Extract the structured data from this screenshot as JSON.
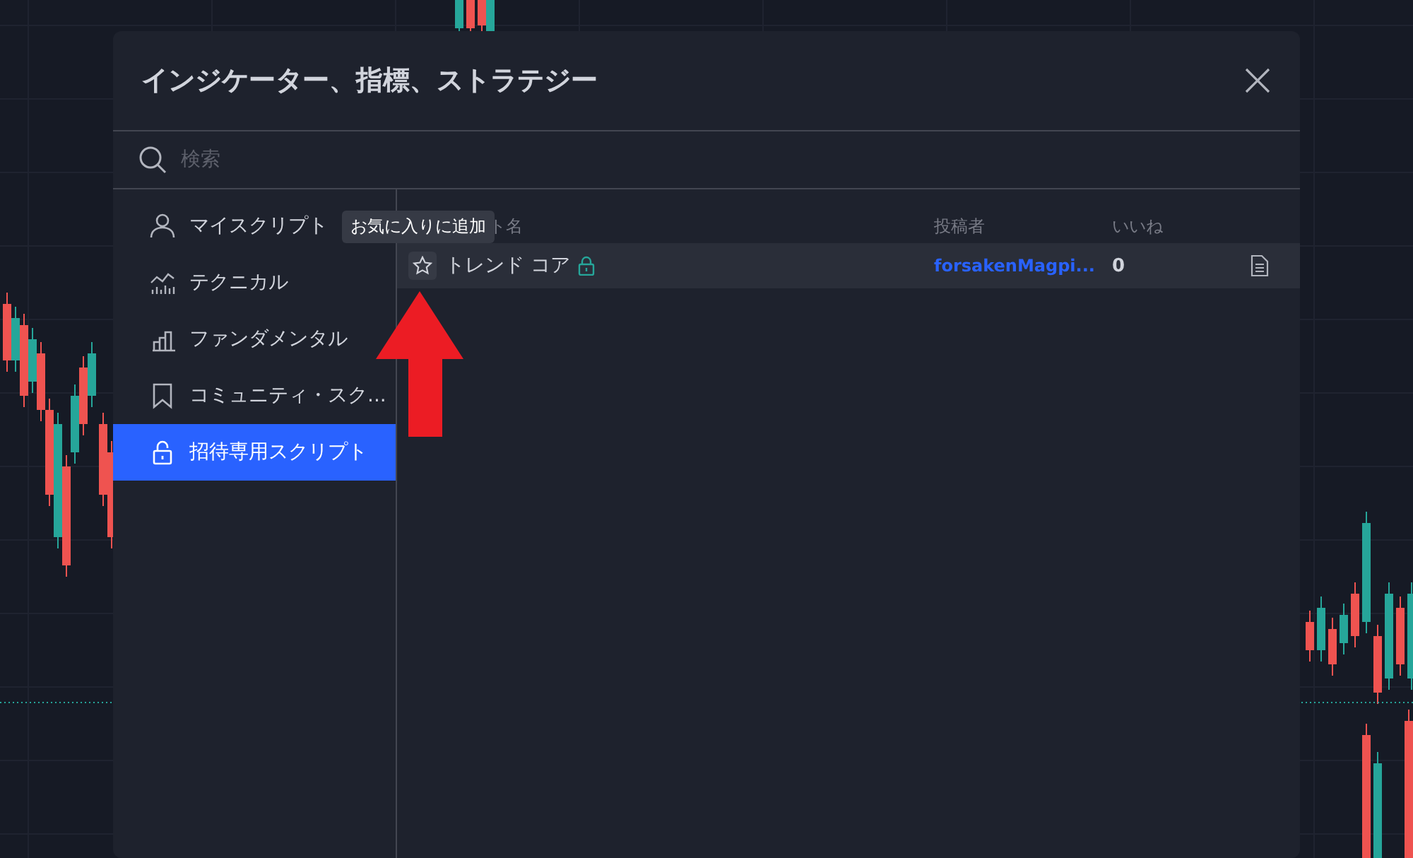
{
  "dialog": {
    "title": "インジケーター、指標、ストラテジー",
    "search": {
      "placeholder": "検索"
    }
  },
  "sidebar": {
    "items": [
      {
        "kind": "person",
        "label": "マイスクリプト",
        "selected": false
      },
      {
        "kind": "technical",
        "label": "テクニカル",
        "selected": false
      },
      {
        "kind": "bars",
        "label": "ファンダメンタル",
        "selected": false
      },
      {
        "kind": "bookmark",
        "label": "コミュニティ・スク...",
        "selected": false
      },
      {
        "kind": "lock",
        "label": "招待専用スクリプト",
        "selected": true
      }
    ]
  },
  "table": {
    "columns": [
      "ト名",
      "投稿者",
      "いいね"
    ],
    "rows": [
      {
        "name": "トレンド コア",
        "locked": true,
        "author": "forsakenMagpi...",
        "likes": "0",
        "selected": true
      }
    ]
  },
  "tooltip": "お気に入りに追加"
}
